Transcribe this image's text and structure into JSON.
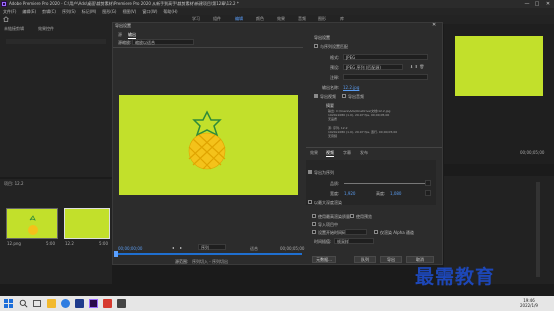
{
  "window": {
    "title": "Adobe Premiere Pro 2020 - C:\\用户\\Ads\\桌面\\裁剪素材\\Premiere Pro 2020 从新手到高手\\裁剪素材\\新建项目\\第12章\\12.2 *",
    "controls": [
      "—",
      "□",
      "✕"
    ]
  },
  "menu": [
    "文件(F)",
    "编辑(E)",
    "剪辑(C)",
    "序列(S)",
    "标记(M)",
    "图形(G)",
    "视图(V)",
    "窗口(W)",
    "帮助(H)"
  ],
  "workspaces": [
    "学习",
    "组件",
    "编辑",
    "颜色",
    "效果",
    "音频",
    "图形",
    "库"
  ],
  "active_workspace": "编辑",
  "left": {
    "source_tab": "未链接剪辑",
    "effects_tab": "效果控件",
    "project_label": "项目: 12.2",
    "bins": [
      {
        "name": "12.png",
        "dur": "5:00"
      },
      {
        "name": "12.2",
        "dur": "5:00"
      }
    ]
  },
  "dialog": {
    "title": "导出设置",
    "tabs": [
      "源",
      "输出"
    ],
    "source_scaling_label": "源缩放:",
    "source_scaling_value": "缩放以适合",
    "timecode_start": "00;00;00;00",
    "timecode_end": "00;00;05;00",
    "range_label": "序列",
    "fit_label": "适合",
    "source_range": "源范围:",
    "source_range_value": "序列切入 - 序列切出",
    "settings": {
      "header": "导出设置",
      "match_label": "与序列设置匹配",
      "format_label": "格式:",
      "format_value": "JPEG",
      "preset_label": "预设:",
      "preset_value": "JPEG 序列 (匹配源)",
      "comments_label": "注释:",
      "output_name_label": "输出名称:",
      "output_name_value": "12.2.jpg",
      "export_video_label": "导出视频",
      "export_audio_label": "导出音频",
      "summary_label": "摘要",
      "summary_output_lines": [
        "输出: C:\\Users\\Ads\\OneDrive\\文档\\12.2.jpg",
        "1920x1080 (1.0), 29.97 fps, 00;00;05;00",
        "无品质"
      ],
      "summary_source_lines": [
        "源: 序列, 12.2",
        "1920x1080 (1.0), 29.97 fps, 逐行, 00;00;05;00",
        "无音频"
      ]
    },
    "sub_tabs": [
      "效果",
      "视频",
      "字幕",
      "发布"
    ],
    "active_sub_tab": "视频",
    "video": {
      "basic_label": "基本视频设置",
      "export_each_frame": "导出为序列",
      "quality_label": "品质:",
      "width_label": "宽度:",
      "height_label": "高度:",
      "width_value": "1,920",
      "height_value": "1,080",
      "max_depth_label": "以最大深度渲染"
    },
    "options": {
      "max_render": "使用最高渲染质量",
      "use_previews": "使用预览",
      "import_project": "导入项目中",
      "frame_blend": "设置开始时间码",
      "alpha_only": "仅渲染 Alpha 通道",
      "interp_label": "时间插值:",
      "interp_value": "帧采样"
    },
    "buttons": {
      "metadata": "元数据...",
      "queue": "队列",
      "export": "导出",
      "cancel": "取消"
    }
  },
  "program": {
    "timecode": "00;00;05;00",
    "label": "完整"
  },
  "timeline": {
    "timecode": "00;00;05;00"
  },
  "watermark": "最需教育",
  "taskbar": {
    "time": "19:46",
    "date": "2022/1/9",
    "search_icon": "search-icon"
  }
}
